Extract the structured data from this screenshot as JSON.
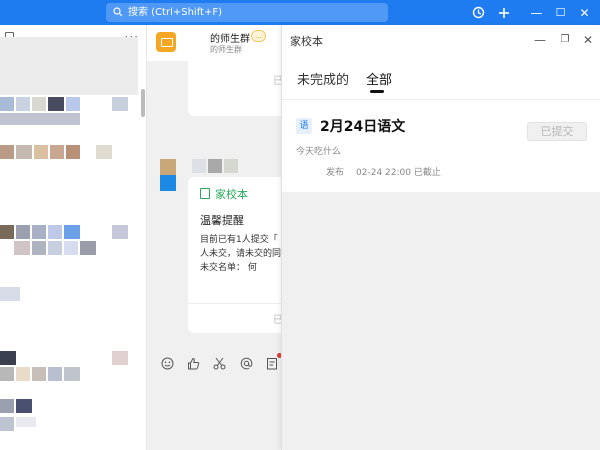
{
  "topbar": {
    "search_placeholder": "搜索 (Ctrl+Shift+F)",
    "history_icon": "history-icon",
    "add_icon": "plus-icon",
    "minimize": "—",
    "maximize": "☐",
    "close": "✕",
    "accent": "#1e7cf0"
  },
  "sidebar": {
    "more": "···"
  },
  "chat": {
    "group_name": "的师生群",
    "group_badge": "…",
    "group_sub": "的师生群",
    "submitted_label": "已",
    "card": {
      "app_name": "家校本",
      "title": "温馨提醒",
      "lines": [
        "目前已有1人提交「",
        "人未交，请未交的同",
        "未交名单：  何"
      ]
    },
    "composer_icons": [
      "emoji-icon",
      "thumbs-up-icon",
      "scissors-icon",
      "at-icon",
      "homework-icon"
    ]
  },
  "panel": {
    "title": "家校本",
    "tabs": [
      {
        "label": "未完成的",
        "active": false
      },
      {
        "label": "全部",
        "active": true
      }
    ],
    "homework": {
      "subject": "语",
      "title": "2月24日语文",
      "desc": "今天吃什么",
      "publish_label": "发布",
      "deadline": "02-24 22:00 已截止",
      "submit_label": "已提交"
    }
  }
}
